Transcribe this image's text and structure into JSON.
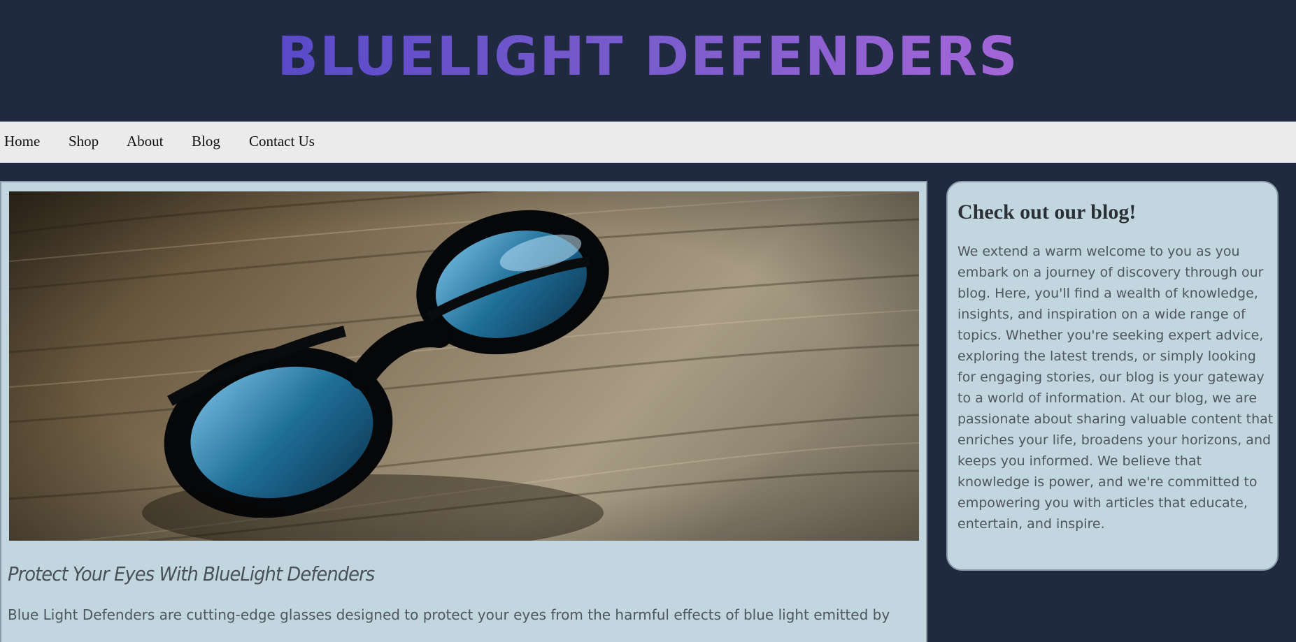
{
  "header": {
    "site_title": "BLUELIGHT DEFENDERS"
  },
  "nav": {
    "items": [
      {
        "label": "Home"
      },
      {
        "label": "Shop"
      },
      {
        "label": "About"
      },
      {
        "label": "Blog"
      },
      {
        "label": "Contact Us"
      }
    ]
  },
  "main": {
    "hero_image_icon": "glasses-photo",
    "article_title": "Protect Your Eyes With BlueLight Defenders",
    "article_body": "Blue Light Defenders are cutting-edge glasses designed to protect your eyes from the harmful effects of blue light emitted by"
  },
  "sidebar": {
    "heading": "Check out our blog!",
    "text": "We extend a warm welcome to you as you embark on a journey of discovery through our blog. Here, you'll find a wealth of knowledge, insights, and inspiration on a wide range of topics. Whether you're seeking expert advice, exploring the latest trends, or simply looking for engaging stories, our blog is your gateway to a world of information. At our blog, we are passionate about sharing valuable content that enriches your life, broadens your horizons, and keeps you informed. We believe that knowledge is power, and we're committed to empowering you with articles that educate, entertain, and inspire."
  },
  "colors": {
    "page_background": "#1f2a40",
    "nav_background": "#ebebeb",
    "panel_background": "#c1d6de",
    "title_gradient_start": "#5a4ac9",
    "title_gradient_end": "#a466d8"
  }
}
